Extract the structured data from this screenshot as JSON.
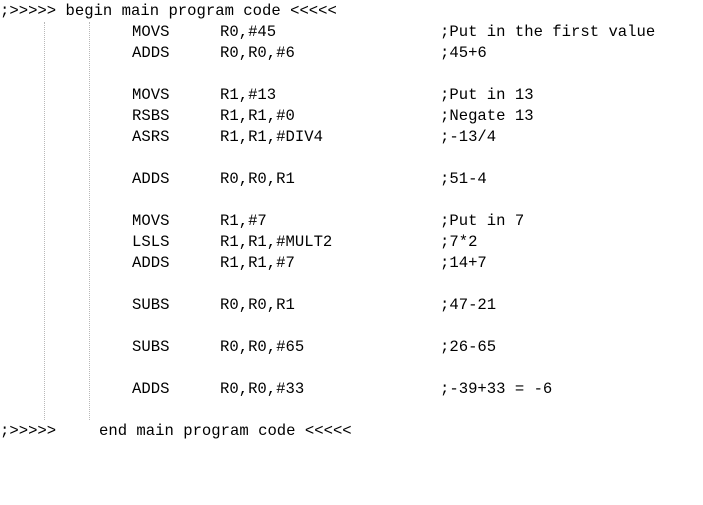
{
  "header_banner": ";>>>>> begin main program code <<<<<",
  "footer_banner": {
    "marker": ";>>>>>",
    "text": "end main program code <<<<<"
  },
  "lines": [
    {
      "mnemonic": "MOVS",
      "operands": "R0,#45",
      "comment": ";Put in the first value"
    },
    {
      "mnemonic": "ADDS",
      "operands": "R0,R0,#6",
      "comment": ";45+6"
    },
    {
      "mnemonic": "",
      "operands": "",
      "comment": ""
    },
    {
      "mnemonic": "MOVS",
      "operands": "R1,#13",
      "comment": ";Put in 13"
    },
    {
      "mnemonic": "RSBS",
      "operands": "R1,R1,#0",
      "comment": ";Negate 13"
    },
    {
      "mnemonic": "ASRS",
      "operands": "R1,R1,#DIV4",
      "comment": ";-13/4"
    },
    {
      "mnemonic": "",
      "operands": "",
      "comment": ""
    },
    {
      "mnemonic": "ADDS",
      "operands": "R0,R0,R1",
      "comment": ";51-4"
    },
    {
      "mnemonic": "",
      "operands": "",
      "comment": ""
    },
    {
      "mnemonic": "MOVS",
      "operands": "R1,#7",
      "comment": ";Put in 7"
    },
    {
      "mnemonic": "LSLS",
      "operands": "R1,R1,#MULT2",
      "comment": ";7*2"
    },
    {
      "mnemonic": "ADDS",
      "operands": "R1,R1,#7",
      "comment": ";14+7"
    },
    {
      "mnemonic": "",
      "operands": "",
      "comment": ""
    },
    {
      "mnemonic": "SUBS",
      "operands": "R0,R0,R1",
      "comment": ";47-21"
    },
    {
      "mnemonic": "",
      "operands": "",
      "comment": ""
    },
    {
      "mnemonic": "SUBS",
      "operands": "R0,R0,#65",
      "comment": ";26-65"
    },
    {
      "mnemonic": "",
      "operands": "",
      "comment": ""
    },
    {
      "mnemonic": "ADDS",
      "operands": "R0,R0,#33",
      "comment": ";-39+33 = -6"
    }
  ]
}
